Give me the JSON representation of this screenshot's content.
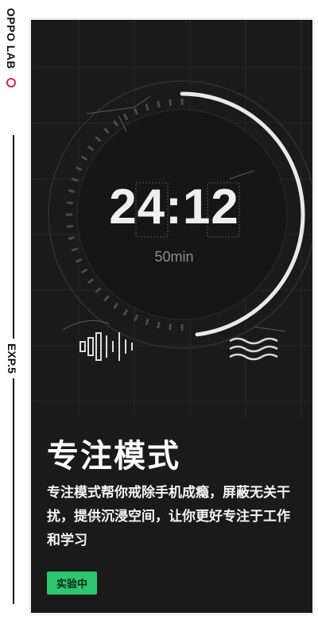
{
  "brand": "OPPO LAB",
  "experiment_label": "EXP.5",
  "timer": {
    "time": "24:12",
    "duration": "50min",
    "progress": 0.48
  },
  "feature": {
    "title": "专注模式",
    "description": "专注模式帮你戒除手机成瘾，屏蔽无关干扰，提供沉浸空间，让你更好专注于工作和学习",
    "status_badge": "实验中"
  },
  "colors": {
    "accent": "#2ec56f",
    "brand_dot": "#e0254b",
    "card_bg": "#1a1a1a"
  },
  "icons": [
    "record-dot-icon",
    "sound-wave-icon",
    "wave-lines-icon"
  ]
}
